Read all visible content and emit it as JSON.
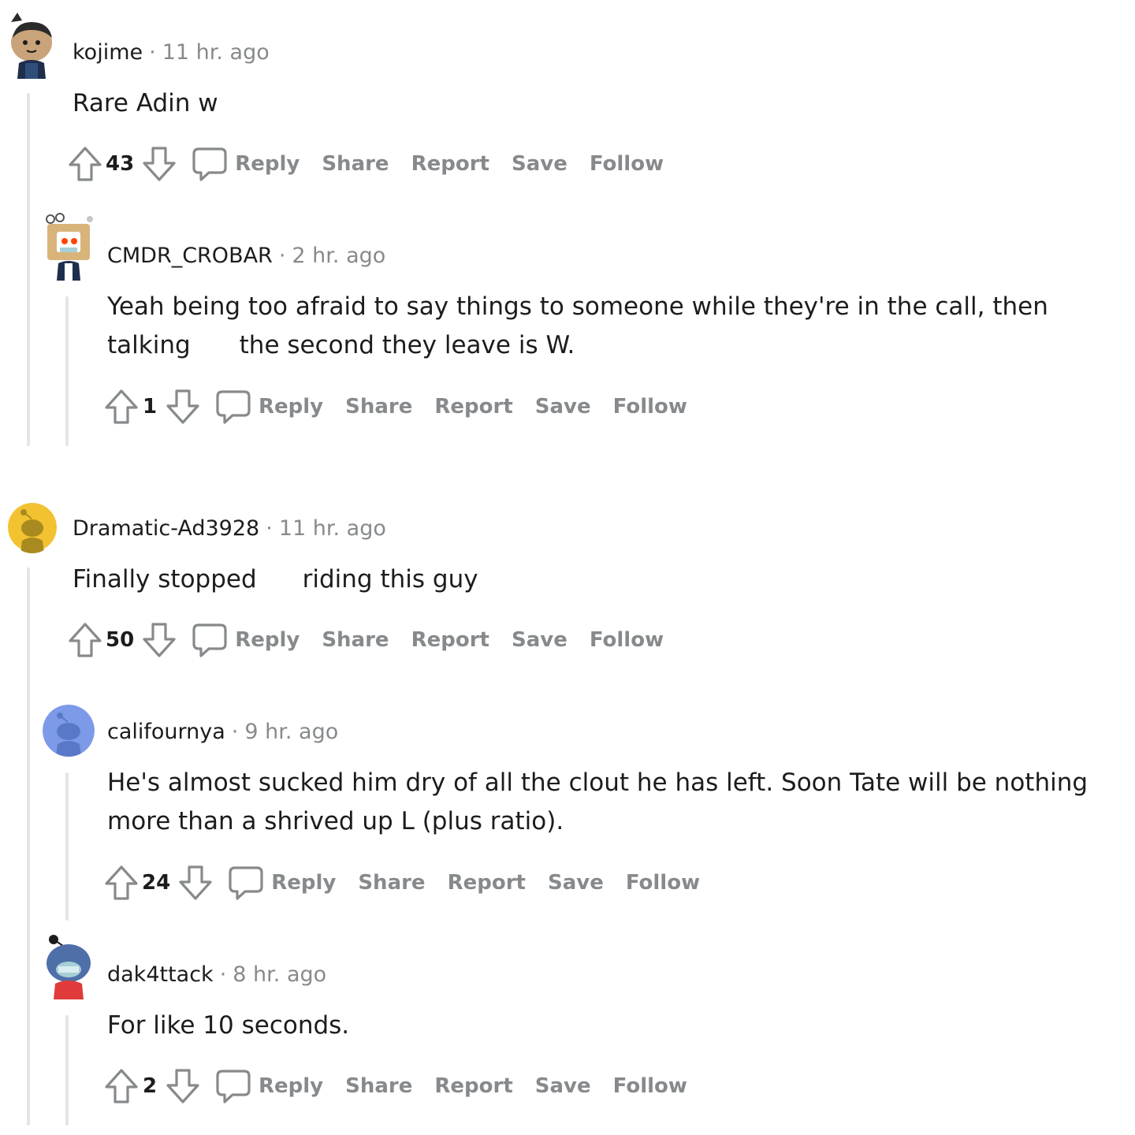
{
  "comments": [
    {
      "author": "kojime",
      "time": "11 hr. ago",
      "body": "Rare Adin w",
      "score": "43"
    },
    {
      "author": "CMDR_CROBAR",
      "time": "2 hr. ago",
      "body_line1": "Yeah being too afraid to say things to someone while they're in the call, then",
      "body_line2a": "talking",
      "body_line2b": "the second they leave is W.",
      "score": "1"
    },
    {
      "author": "Dramatic-Ad3928",
      "time": "11 hr. ago",
      "body_a": "Finally stopped",
      "body_b": "riding this guy",
      "score": "50"
    },
    {
      "author": "califournya",
      "time": "9 hr. ago",
      "body_line1": "He's almost sucked him dry of all the clout he has left. Soon Tate will be nothing",
      "body_line2": "more than a shrived up L (plus ratio).",
      "score": "24"
    },
    {
      "author": "dak4ttack",
      "time": "8 hr. ago",
      "body": "For like 10 seconds.",
      "score": "2"
    }
  ],
  "actions": {
    "reply": "Reply",
    "share": "Share",
    "report": "Report",
    "save": "Save",
    "follow": "Follow"
  },
  "separator": "·",
  "icons": {
    "upvote": "upvote-arrow-icon",
    "downvote": "downvote-arrow-icon",
    "reply": "speech-bubble-icon"
  },
  "colors": {
    "muted": "#878a8c",
    "text": "#1c1c1c",
    "thread_line": "#e5e5e5",
    "avatar_yellow": "#f2c230",
    "avatar_blue": "#7c9ae8"
  }
}
